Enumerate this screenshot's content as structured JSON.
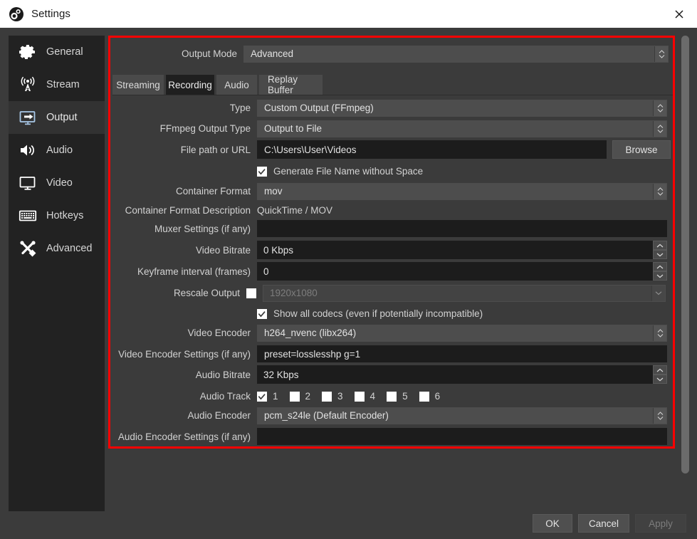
{
  "window": {
    "title": "Settings",
    "app_icon": "obs-logo-icon",
    "close_icon": "close-icon"
  },
  "sidebar": {
    "items": [
      {
        "label": "General",
        "icon": "gear-icon",
        "selected": false
      },
      {
        "label": "Stream",
        "icon": "broadcast-icon",
        "selected": false
      },
      {
        "label": "Output",
        "icon": "output-icon",
        "selected": true
      },
      {
        "label": "Audio",
        "icon": "speaker-icon",
        "selected": false
      },
      {
        "label": "Video",
        "icon": "monitor-icon",
        "selected": false
      },
      {
        "label": "Hotkeys",
        "icon": "keyboard-icon",
        "selected": false
      },
      {
        "label": "Advanced",
        "icon": "tools-icon",
        "selected": false
      }
    ]
  },
  "output_mode": {
    "label": "Output Mode",
    "value": "Advanced"
  },
  "tabs": [
    {
      "label": "Streaming",
      "active": false
    },
    {
      "label": "Recording",
      "active": true
    },
    {
      "label": "Audio",
      "active": false
    },
    {
      "label": "Replay Buffer",
      "active": false
    }
  ],
  "form": {
    "type": {
      "label": "Type",
      "value": "Custom Output (FFmpeg)"
    },
    "ffmpeg_output_type": {
      "label": "FFmpeg Output Type",
      "value": "Output to File"
    },
    "file_path": {
      "label": "File path or URL",
      "value": "C:\\Users\\User\\Videos",
      "browse_label": "Browse"
    },
    "generate_no_space": {
      "label": "Generate File Name without Space",
      "checked": true
    },
    "container_format": {
      "label": "Container Format",
      "value": "mov"
    },
    "container_format_description": {
      "label": "Container Format Description",
      "value": "QuickTime / MOV"
    },
    "muxer_settings": {
      "label": "Muxer Settings (if any)",
      "value": ""
    },
    "video_bitrate": {
      "label": "Video Bitrate",
      "value": "0 Kbps"
    },
    "keyframe_interval": {
      "label": "Keyframe interval (frames)",
      "value": "0"
    },
    "rescale_output": {
      "label": "Rescale Output",
      "checked": false,
      "value": "1920x1080",
      "disabled": true
    },
    "show_all_codecs": {
      "label": "Show all codecs (even if potentially incompatible)",
      "checked": true
    },
    "video_encoder": {
      "label": "Video Encoder",
      "value": "h264_nvenc (libx264)"
    },
    "video_encoder_settings": {
      "label": "Video Encoder Settings (if any)",
      "value": "preset=losslesshp g=1"
    },
    "audio_bitrate": {
      "label": "Audio Bitrate",
      "value": "32 Kbps"
    },
    "audio_track": {
      "label": "Audio Track",
      "tracks": [
        {
          "num": "1",
          "checked": true
        },
        {
          "num": "2",
          "checked": false
        },
        {
          "num": "3",
          "checked": false
        },
        {
          "num": "4",
          "checked": false
        },
        {
          "num": "5",
          "checked": false
        },
        {
          "num": "6",
          "checked": false
        }
      ]
    },
    "audio_encoder": {
      "label": "Audio Encoder",
      "value": "pcm_s24le (Default Encoder)"
    },
    "audio_encoder_settings": {
      "label": "Audio Encoder Settings (if any)",
      "value": ""
    }
  },
  "footer": {
    "ok": "OK",
    "cancel": "Cancel",
    "apply": "Apply",
    "apply_disabled": true
  },
  "colors": {
    "highlight_border": "#fe0000",
    "window_bg": "#3b3b3b",
    "sidebar_bg": "#222222",
    "titlebar_bg": "#ffffff"
  }
}
